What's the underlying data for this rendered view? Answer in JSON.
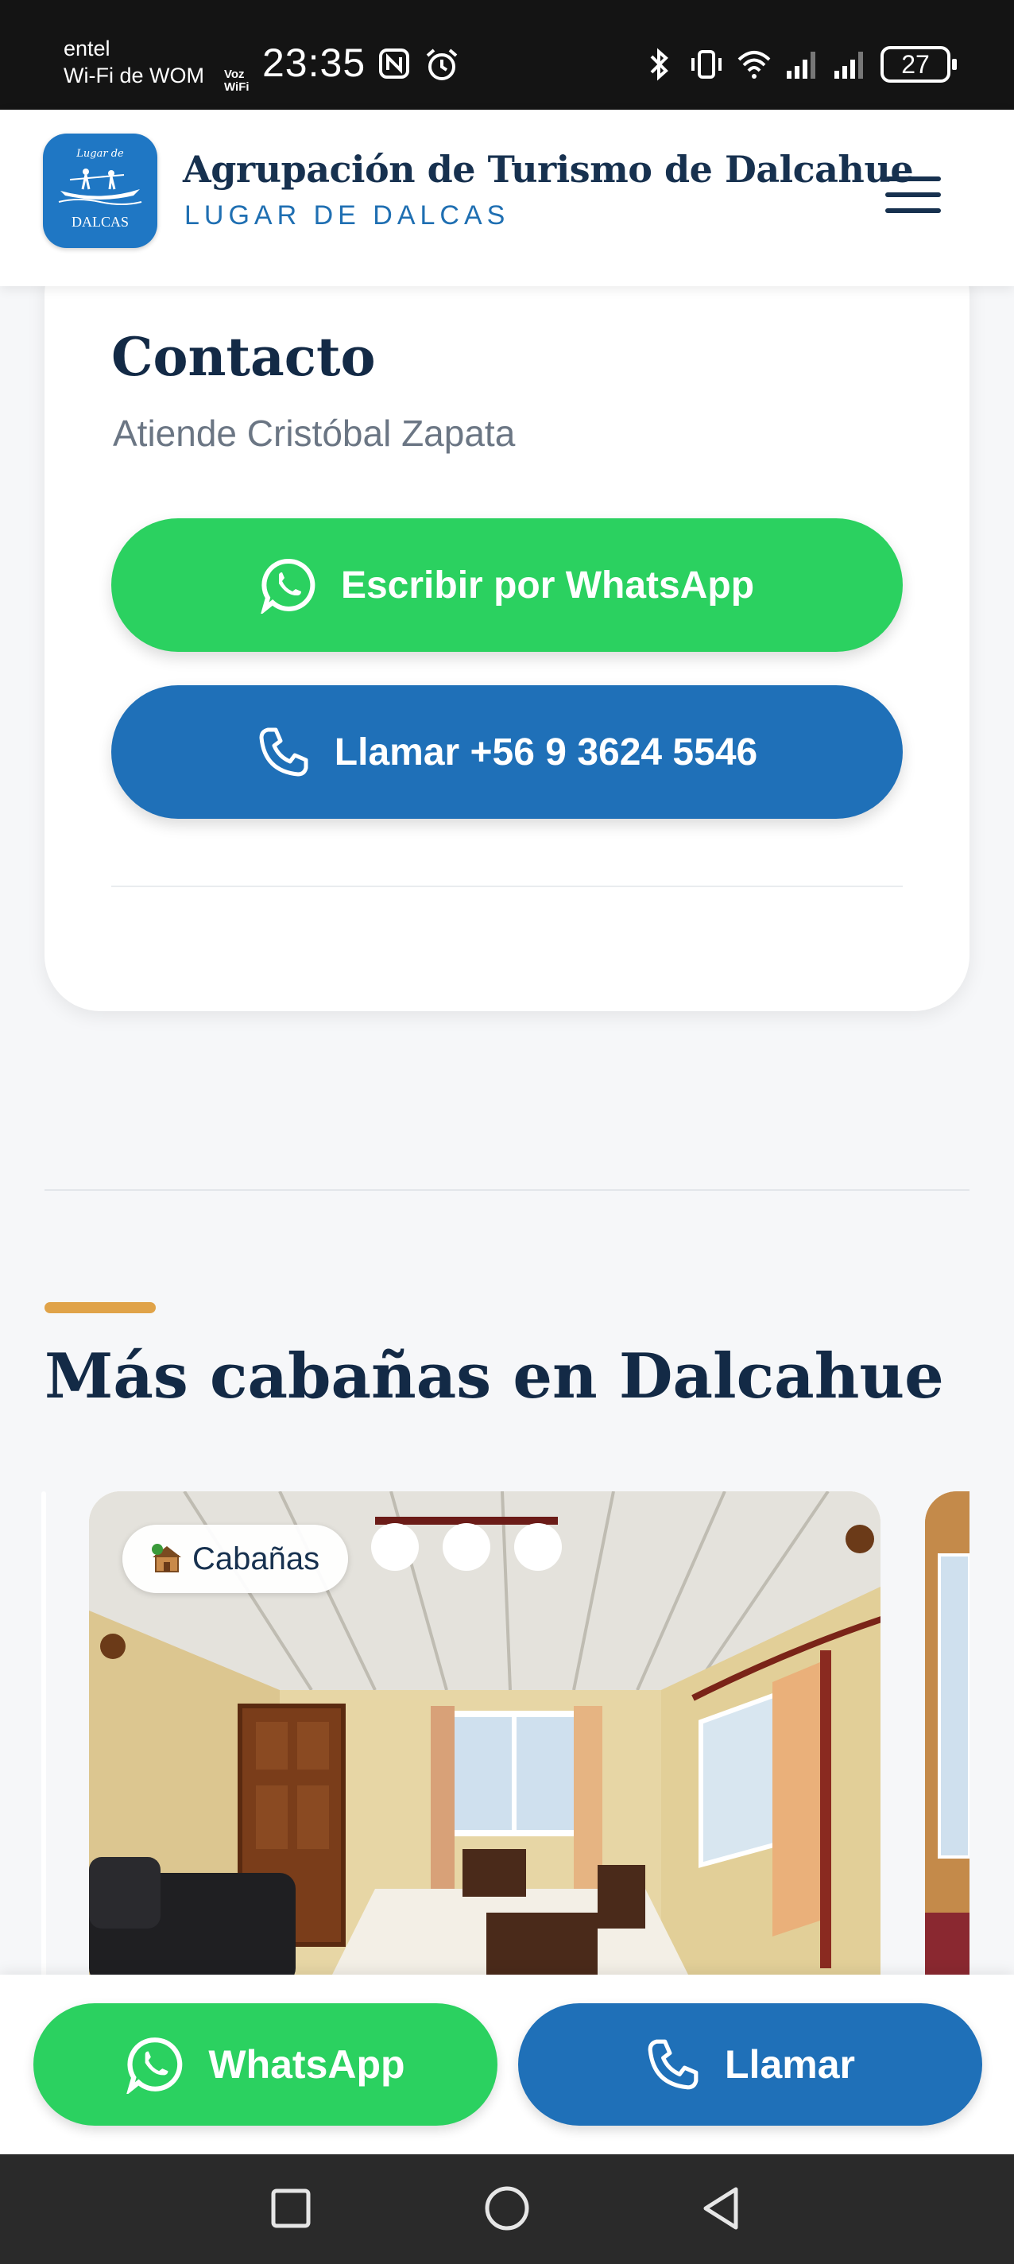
{
  "status_bar": {
    "carrier_line1": "entel",
    "carrier_line2": "Wi-Fi de WOM",
    "voz_wifi_top": "Voz",
    "voz_wifi_bottom": "WiFi",
    "time": "23:35",
    "battery": "27",
    "icons": [
      "nfc-icon",
      "alarm-icon",
      "bluetooth-icon",
      "vibrate-icon",
      "wifi-icon",
      "signal-icon",
      "signal-icon",
      "battery-icon"
    ]
  },
  "header": {
    "logo_top": "Lugar de",
    "logo_bottom": "DALCAS",
    "title": "Agrupación de Turismo de Dalcahue",
    "subtitle": "LUGAR DE DALCAS",
    "menu_icon": "hamburger-menu-icon"
  },
  "contact": {
    "title": "Contacto",
    "subtitle": "Atiende Cristóbal Zapata",
    "whatsapp_label": "Escribir por WhatsApp",
    "call_label": "Llamar +56 9 3624 5546"
  },
  "section": {
    "title": "Más cabañas en Dalcahue"
  },
  "carousel": {
    "badge_label": "Cabañas",
    "badge_icon": "cabin-emoji-icon"
  },
  "bottom_bar": {
    "whatsapp_label": "WhatsApp",
    "call_label": "Llamar"
  },
  "colors": {
    "whatsapp_green": "#2bd160",
    "call_blue": "#1f70b8",
    "navy": "#132a46",
    "accent_gold": "#e0a349"
  }
}
